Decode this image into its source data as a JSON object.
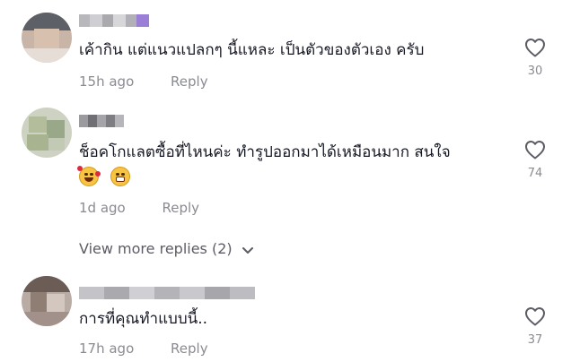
{
  "comments": [
    {
      "text": "เค้ากิน แต่แนวแปลกๆ นี้แหละ เป็นตัวของตัวเอง ครับ",
      "time": "15h ago",
      "reply_label": "Reply",
      "likes": "30",
      "like_icon": "heart-outline-icon"
    },
    {
      "text": "ช็อคโกแลตซื้อที่ไหนค่ะ ทำรูปออกมาได้เหมือนมาก สนใจ",
      "emojis": [
        "smiling-face-with-hearts-icon",
        "grinning-face-icon"
      ],
      "time": "1d ago",
      "reply_label": "Reply",
      "likes": "74",
      "like_icon": "heart-outline-icon"
    },
    {
      "text": "การที่คุณทำแบบนี้..",
      "time": "17h ago",
      "reply_label": "Reply",
      "likes": "37",
      "like_icon": "heart-outline-icon"
    }
  ],
  "view_more_replies": "View more replies (2)",
  "colors": {
    "text_primary": "#161823",
    "text_secondary": "#8a8b91",
    "heart_stroke": "#5c5d64"
  }
}
